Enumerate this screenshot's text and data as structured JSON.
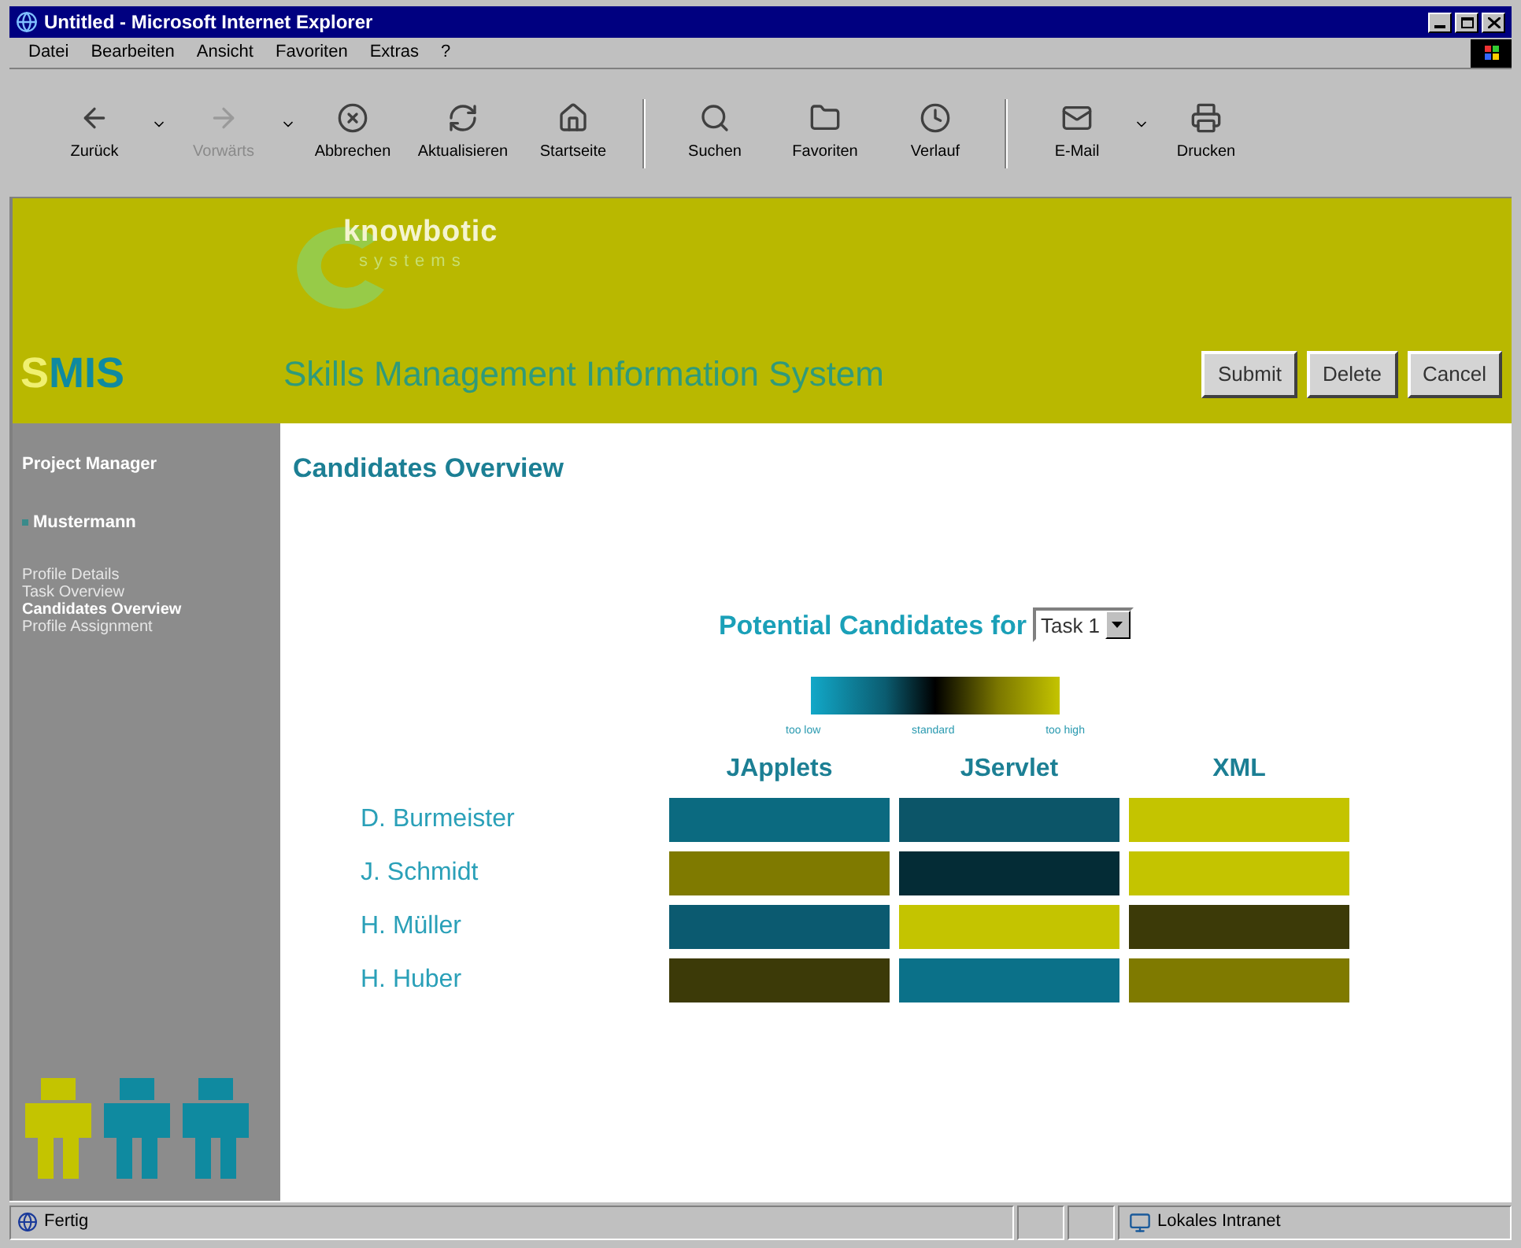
{
  "window": {
    "title": "Untitled - Microsoft Internet Explorer"
  },
  "menu": [
    "Datei",
    "Bearbeiten",
    "Ansicht",
    "Favoriten",
    "Extras",
    "?"
  ],
  "toolbar": [
    {
      "kind": "back",
      "label": "Zurück",
      "disabled": false
    },
    {
      "kind": "forward",
      "label": "Vorwärts",
      "disabled": true
    },
    {
      "kind": "stop",
      "label": "Abbrechen",
      "disabled": false
    },
    {
      "kind": "refresh",
      "label": "Aktualisieren",
      "disabled": false
    },
    {
      "kind": "home",
      "label": "Startseite",
      "disabled": false
    },
    {
      "kind": "search",
      "label": "Suchen",
      "disabled": false
    },
    {
      "kind": "favorites",
      "label": "Favoriten",
      "disabled": false
    },
    {
      "kind": "history",
      "label": "Verlauf",
      "disabled": false
    },
    {
      "kind": "mail",
      "label": "E-Mail",
      "disabled": false
    },
    {
      "kind": "print",
      "label": "Drucken",
      "disabled": false
    }
  ],
  "header": {
    "logo_top": "knowbotic",
    "logo_bottom": "systems",
    "app_initial": "S",
    "app_rest": "MIS",
    "app_title": "Skills Management Information System",
    "buttons": [
      "Submit",
      "Delete",
      "Cancel"
    ]
  },
  "sidebar": {
    "role": "Project Manager",
    "user": "Mustermann",
    "items": [
      {
        "label": "Profile Details",
        "selected": false
      },
      {
        "label": "Task Overview",
        "selected": false
      },
      {
        "label": "Candidates Overview",
        "selected": true
      },
      {
        "label": "Profile Assignment",
        "selected": false
      }
    ]
  },
  "content": {
    "title": "Candidates Overview",
    "filter_label": "Potential Candidates for",
    "task": "Task 1",
    "legend": [
      "too low",
      "standard",
      "too high"
    ],
    "columns": [
      "JApplets",
      "JServlet",
      "XML"
    ],
    "rows": [
      {
        "name": "D. Burmeister",
        "cells": [
          {
            "color": "#0b6a80"
          },
          {
            "color": "#0c5568"
          },
          {
            "color": "#c4c400"
          }
        ]
      },
      {
        "name": "J. Schmidt",
        "cells": [
          {
            "color": "#7f7a00"
          },
          {
            "color": "#042c36"
          },
          {
            "color": "#c4c400"
          }
        ]
      },
      {
        "name": "H. Müller",
        "cells": [
          {
            "color": "#0b5a70"
          },
          {
            "color": "#c4c400"
          },
          {
            "color": "#3c3a08"
          }
        ]
      },
      {
        "name": "H. Huber",
        "cells": [
          {
            "color": "#3c3a08"
          },
          {
            "color": "#0b7189"
          },
          {
            "color": "#7f7a00"
          }
        ]
      }
    ]
  },
  "status_bar": {
    "status": "Fertig",
    "zone": "Lokales Intranet"
  }
}
